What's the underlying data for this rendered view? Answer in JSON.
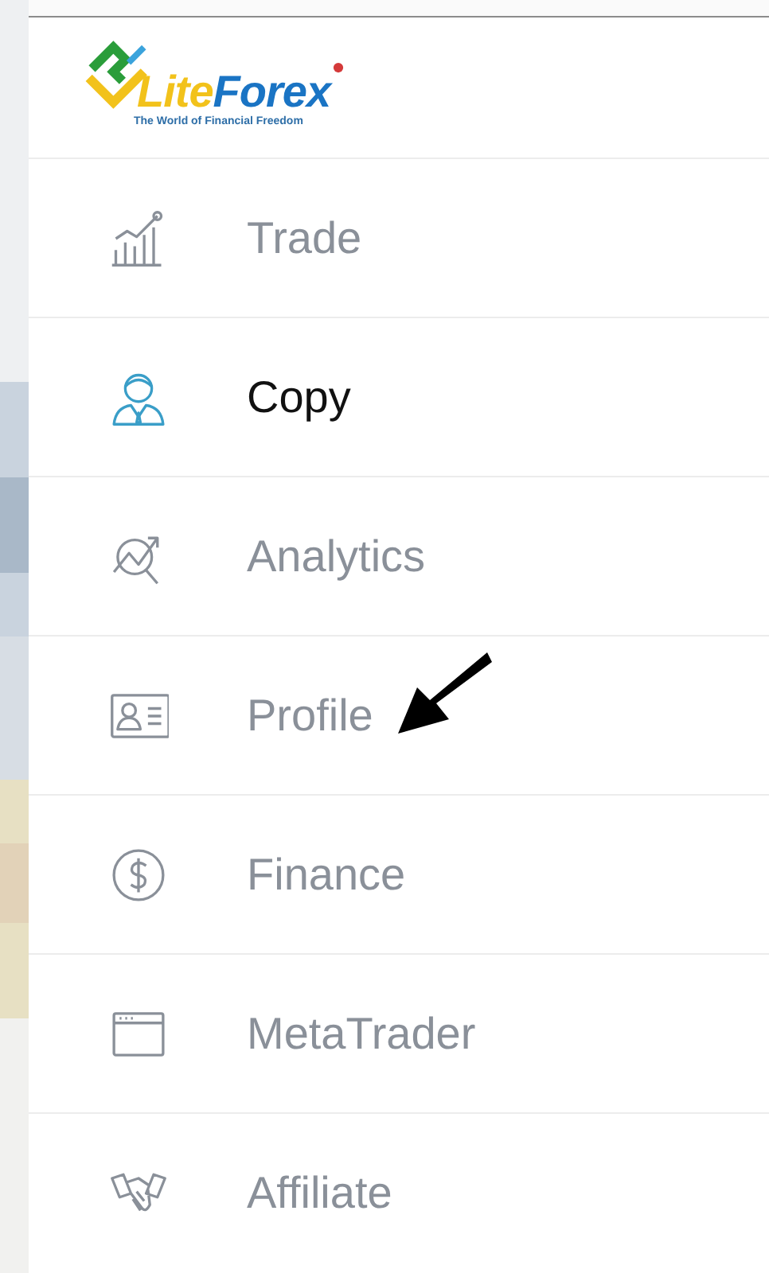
{
  "logo": {
    "brand_parts": [
      "Lite",
      "Forex"
    ],
    "tagline": "The World of Financial Freedom"
  },
  "menu": [
    {
      "label": "Trade",
      "selected": false
    },
    {
      "label": "Copy",
      "selected": true
    },
    {
      "label": "Analytics",
      "selected": false
    },
    {
      "label": "Profile",
      "selected": false
    },
    {
      "label": "Finance",
      "selected": false
    },
    {
      "label": "MetaTrader",
      "selected": false
    },
    {
      "label": "Affiliate",
      "selected": false
    }
  ]
}
